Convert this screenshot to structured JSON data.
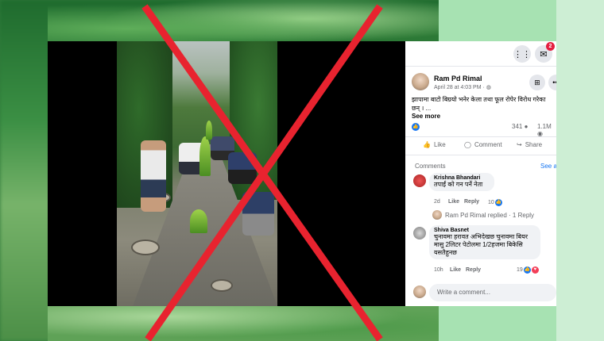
{
  "post": {
    "author": "Ram Pd Rimal",
    "timestamp": "April 28 at 4:03 PM ·",
    "text": "झापामा बाटो बिग्रयो भनेर केला तथा फूल रोपेर विरोध गरेका छन् । ...",
    "see_more": "See more",
    "reaction_count": "341",
    "views": "1.1M"
  },
  "actions": {
    "like": "Like",
    "comment": "Comment",
    "share": "Share"
  },
  "comments_section": {
    "header": "Comments",
    "see_all": "See a"
  },
  "comments": [
    {
      "name": "Krishna Bhandari",
      "text": "तपाईं को गन पर्ने नेता",
      "age": "2d",
      "like": "Like",
      "reply": "Reply",
      "reactions": "10"
    },
    {
      "name": "Shiva Basnet",
      "text": "चुनावमा हरावत अभिदेखछ चुनावमा बियर मासु 2लिटर पेटोलमा 1/2हजमा बिकेसि यसतैहुनछ",
      "age": "10h",
      "like": "Like",
      "reply": "Reply",
      "reactions": "19"
    }
  ],
  "reply_note": "Ram Pd Rimal replied · 1 Reply",
  "composer": {
    "placeholder": "Write a comment..."
  },
  "header": {
    "notification_count": "2"
  },
  "colors": {
    "fb_blue": "#1877f2",
    "red_x": "#e8232f",
    "love": "#f33e58"
  }
}
